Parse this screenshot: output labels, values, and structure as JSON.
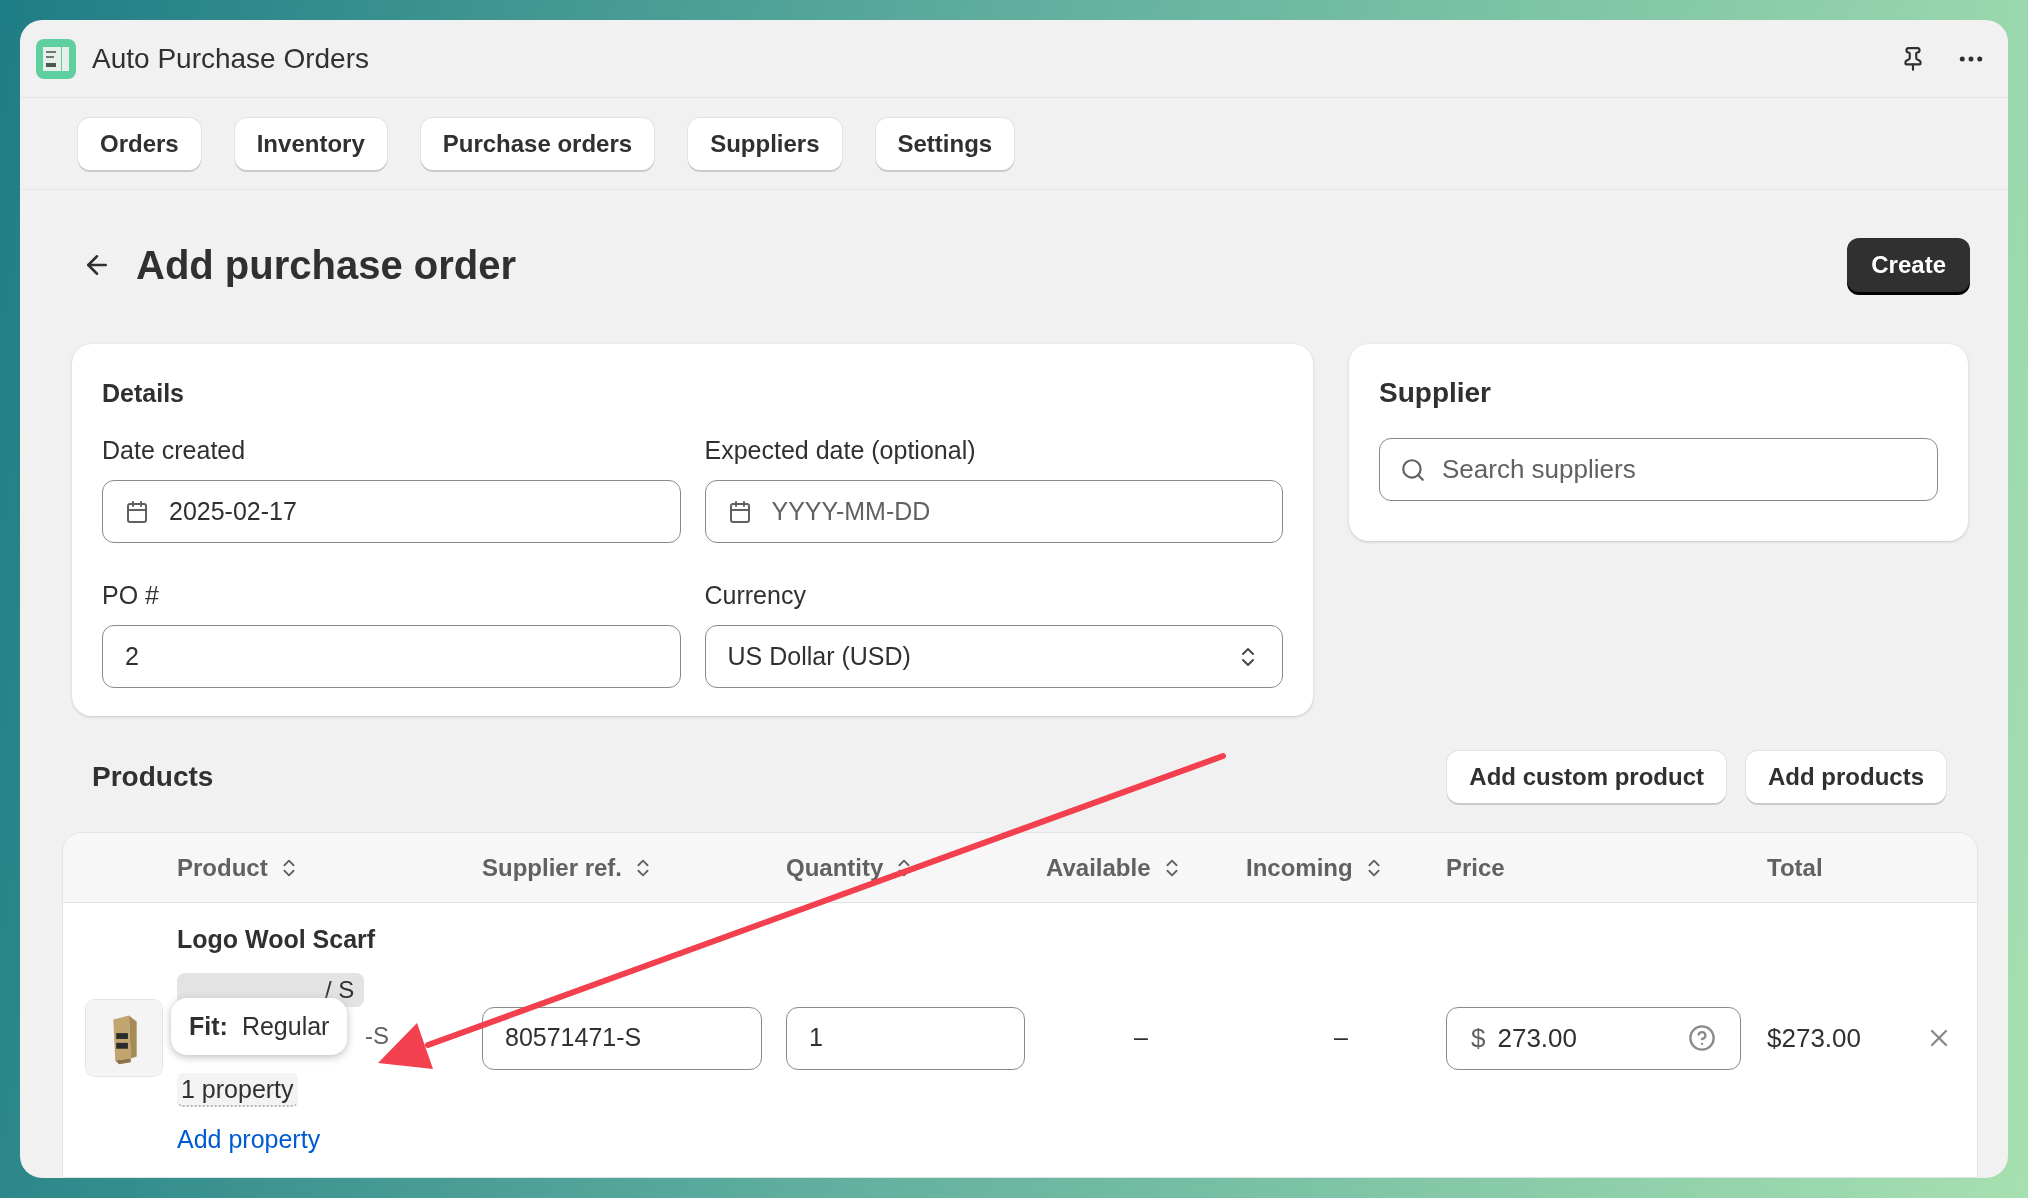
{
  "app": {
    "title": "Auto Purchase Orders"
  },
  "nav": [
    {
      "label": "Orders"
    },
    {
      "label": "Inventory"
    },
    {
      "label": "Purchase orders"
    },
    {
      "label": "Suppliers"
    },
    {
      "label": "Settings"
    }
  ],
  "page": {
    "title": "Add purchase order",
    "primary_action": "Create"
  },
  "details": {
    "title": "Details",
    "fields": [
      {
        "kind": "date",
        "label": "Date created",
        "value": "2025-02-17"
      },
      {
        "kind": "date",
        "label": "Expected date (optional)",
        "placeholder": "YYYY-MM-DD"
      },
      {
        "kind": "text",
        "label": "PO #",
        "value": "2"
      },
      {
        "kind": "select",
        "label": "Currency",
        "value": "US Dollar (USD)"
      }
    ]
  },
  "supplier": {
    "title": "Supplier",
    "search": {
      "placeholder": "Search suppliers"
    }
  },
  "products": {
    "title": "Products",
    "buttons": [
      "Add custom product",
      "Add products"
    ],
    "columns": [
      {
        "label": "Product",
        "sortable": true
      },
      {
        "label": "Supplier ref.",
        "sortable": true
      },
      {
        "label": "Quantity",
        "sortable": true
      },
      {
        "label": "Available",
        "sortable": true
      },
      {
        "label": "Incoming",
        "sortable": true
      },
      {
        "label": "Price",
        "sortable": false
      },
      {
        "label": "Total",
        "sortable": false
      }
    ],
    "rows": [
      {
        "name": "Logo Wool Scarf",
        "variant": "/ S",
        "sku": "-S",
        "property_count": "1 property",
        "add_property": "Add property",
        "supplier_ref": "80571471-S",
        "quantity": "1",
        "available": "–",
        "incoming": "–",
        "currency": "$",
        "price": "273.00",
        "total": "$273.00"
      }
    ]
  },
  "tooltip": {
    "label": "Fit:",
    "value": "Regular"
  }
}
